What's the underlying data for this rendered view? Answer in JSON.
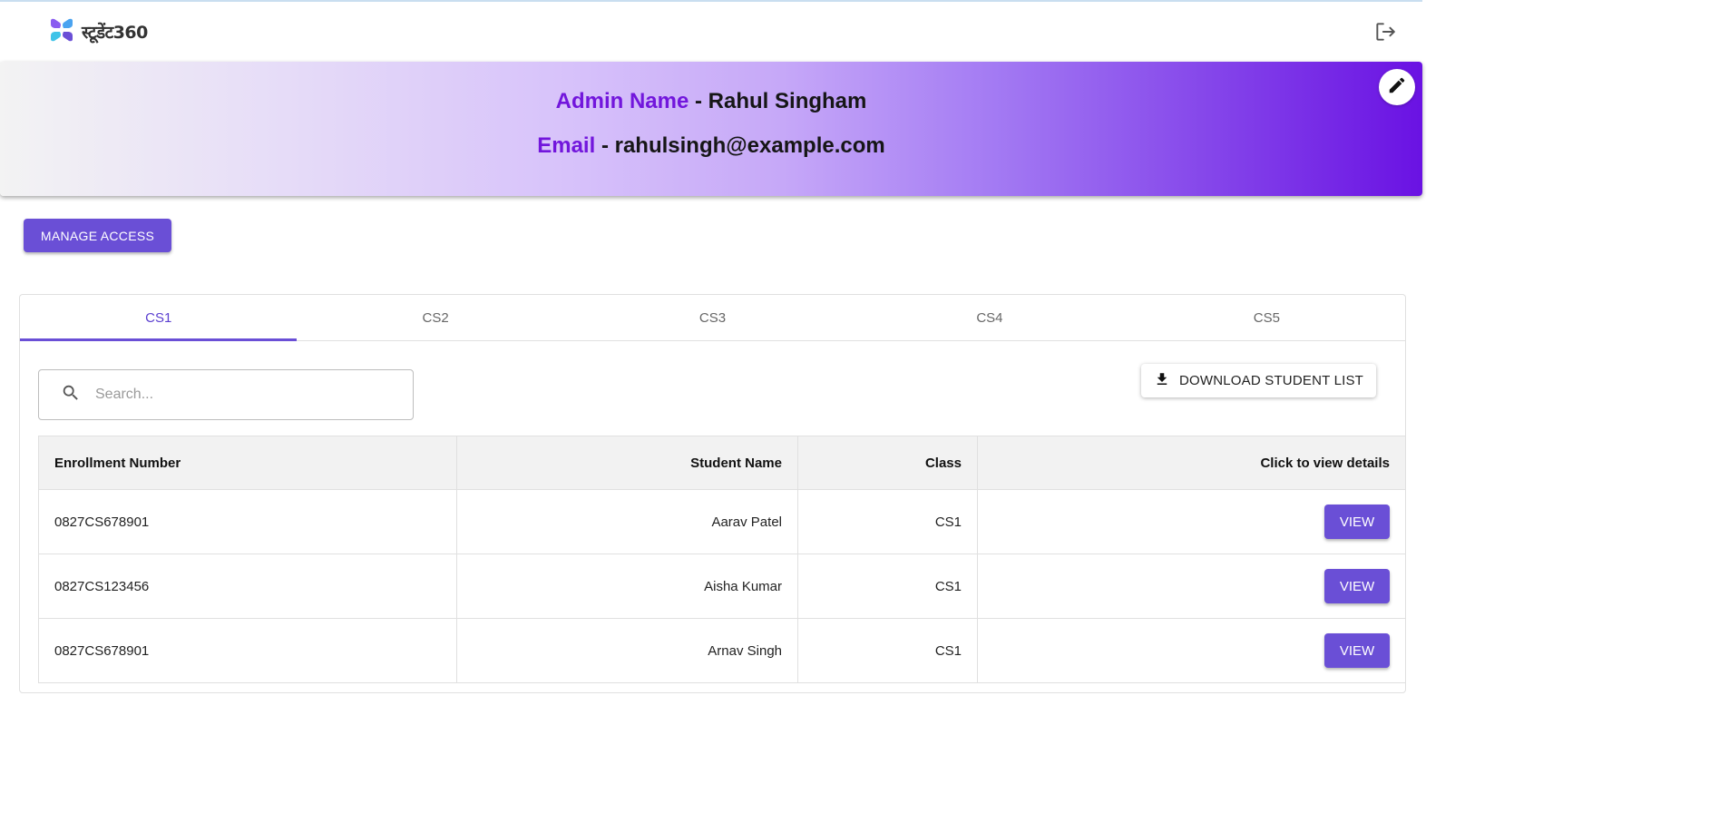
{
  "app": {
    "logo_text": "स्टूडेंट360"
  },
  "profile": {
    "name_label": "Admin Name",
    "name_value": "- Rahul Singham",
    "email_label": "Email",
    "email_value": "- rahulsingh@example.com"
  },
  "actions": {
    "manage_access_label": "MANAGE ACCESS"
  },
  "tabs": [
    {
      "label": "CS1",
      "active": true
    },
    {
      "label": "CS2",
      "active": false
    },
    {
      "label": "CS3",
      "active": false
    },
    {
      "label": "CS4",
      "active": false
    },
    {
      "label": "CS5",
      "active": false
    }
  ],
  "search": {
    "placeholder": "Search..."
  },
  "download": {
    "label": "DOWNLOAD STUDENT LIST"
  },
  "table": {
    "headers": [
      "Enrollment Number",
      "Student Name",
      "Class",
      "Click to view details"
    ],
    "rows": [
      {
        "enrollment": "0827CS678901",
        "name": "Aarav Patel",
        "class": "CS1",
        "action": "VIEW"
      },
      {
        "enrollment": "0827CS123456",
        "name": "Aisha Kumar",
        "class": "CS1",
        "action": "VIEW"
      },
      {
        "enrollment": "0827CS678901",
        "name": "Arnav Singh",
        "class": "CS1",
        "action": "VIEW"
      }
    ]
  },
  "colors": {
    "accent": "#6a4fd6",
    "label_purple": "#7216dc",
    "banner_end": "#6a12e3"
  },
  "icons": [
    "logo-icon",
    "logout-icon",
    "edit-icon",
    "search-icon",
    "download-icon"
  ]
}
